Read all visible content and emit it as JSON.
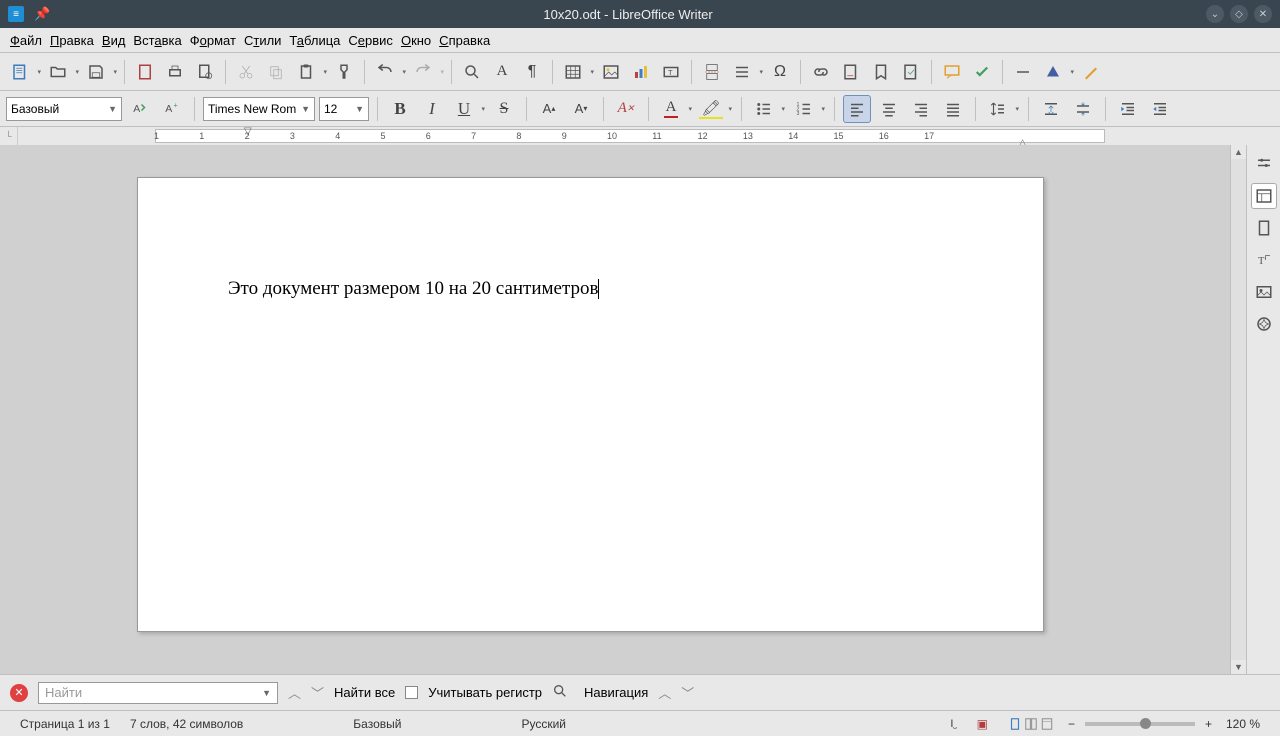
{
  "titlebar": {
    "title": "10x20.odt - LibreOffice Writer"
  },
  "menubar": [
    "Файл",
    "Правка",
    "Вид",
    "Вставка",
    "Формат",
    "Стили",
    "Таблица",
    "Сервис",
    "Окно",
    "Справка"
  ],
  "toolbar2": {
    "style": "Базовый",
    "font": "Times New Rom",
    "size": "12"
  },
  "ruler": {
    "ticks": [
      "1",
      "1",
      "2",
      "3",
      "4",
      "5",
      "6",
      "7",
      "8",
      "9",
      "10",
      "11",
      "12",
      "13",
      "14",
      "15",
      "16",
      "17"
    ]
  },
  "document": {
    "text": "Это документ размером 10 на 20 сантиметров"
  },
  "findbar": {
    "placeholder": "Найти",
    "find_all": "Найти все",
    "match_case": "Учитывать регистр",
    "navigation": "Навигация"
  },
  "statusbar": {
    "page": "Страница 1 из 1",
    "words": "7 слов, 42 символов",
    "style": "Базовый",
    "lang": "Русский",
    "zoom": "120 %"
  }
}
